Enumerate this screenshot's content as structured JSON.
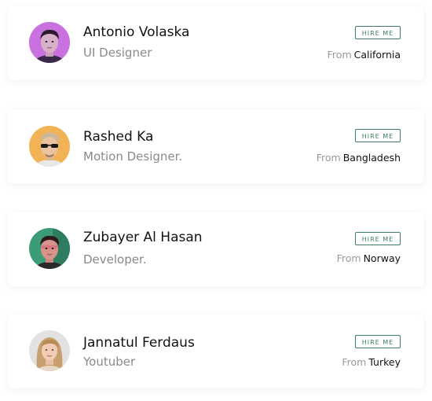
{
  "profiles": [
    {
      "name": "Antonio Volaska",
      "role": "UI Designer",
      "hire_label": "HIRE ME",
      "from_prefix": "From",
      "location": "California",
      "avatar_icon": "avatar-man-pink"
    },
    {
      "name": "Rashed Ka",
      "role": "Motion Designer.",
      "hire_label": "HIRE ME",
      "from_prefix": "From",
      "location": "Bangladesh",
      "avatar_icon": "avatar-man-sunglasses"
    },
    {
      "name": "Zubayer Al Hasan",
      "role": "Developer.",
      "hire_label": "HIRE ME",
      "from_prefix": "From",
      "location": "Norway",
      "avatar_icon": "avatar-man-green"
    },
    {
      "name": "Jannatul Ferdaus",
      "role": "Youtuber",
      "hire_label": "HIRE ME",
      "from_prefix": "From",
      "location": "Turkey",
      "avatar_icon": "avatar-woman"
    }
  ],
  "colors": {
    "accent": "#3e7d5e",
    "name_text": "#111111",
    "muted_text": "#8a8a8a"
  }
}
